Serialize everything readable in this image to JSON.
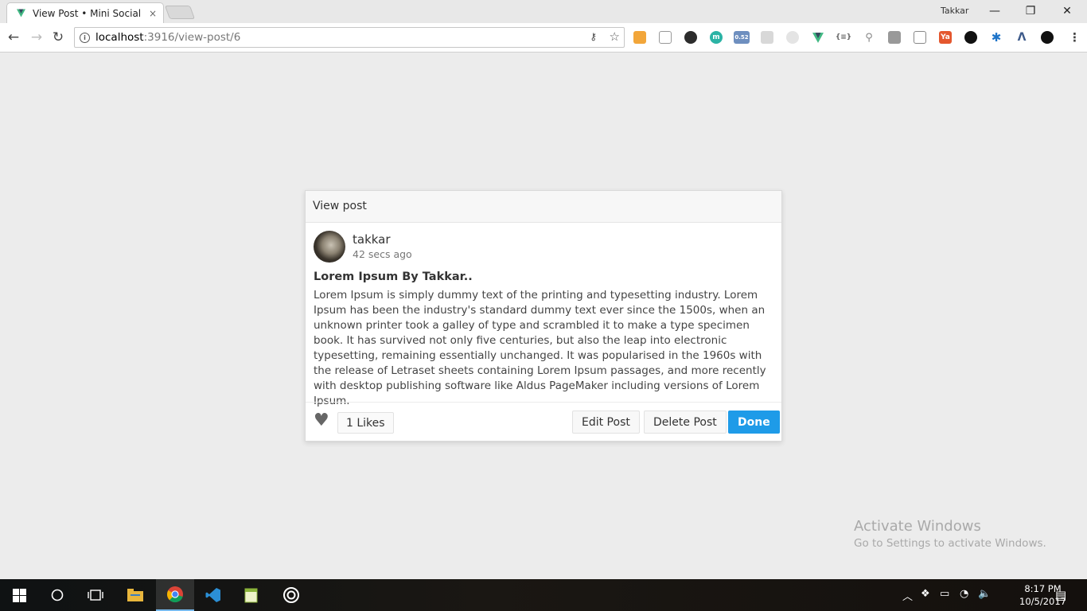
{
  "browser": {
    "tab_title": "View Post • Mini Social N",
    "tab_close": "×",
    "profile_name": "Takkar",
    "url_host": "localhost",
    "url_path": ":3916/view-post/6",
    "ext_badge": "0.52",
    "win_minimize": "—",
    "win_restore": "❐",
    "win_close": "✕"
  },
  "modal": {
    "header_title": "View post",
    "author_name": "takkar",
    "posted_time": "42 secs ago",
    "post_title": "Lorem Ipsum By Takkar..",
    "post_body": "Lorem Ipsum is simply dummy text of the printing and typesetting industry. Lorem Ipsum has been the industry's standard dummy text ever since the 1500s, when an unknown printer took a galley of type and scrambled it to make a type specimen book. It has survived not only five centuries, but also the leap into electronic typesetting, remaining essentially unchanged. It was popularised in the 1960s with the release of Letraset sheets containing Lorem Ipsum passages, and more recently with desktop publishing software like Aldus PageMaker including versions of Lorem Ipsum.",
    "likes_label": "1 Likes",
    "edit_label": "Edit Post",
    "delete_label": "Delete Post",
    "done_label": "Done"
  },
  "watermark": {
    "line1": "Activate Windows",
    "line2": "Go to Settings to activate Windows."
  },
  "taskbar": {
    "time": "8:17 PM",
    "date": "10/5/2017"
  },
  "colors": {
    "accent": "#1e9be8",
    "page_background": "#ececec"
  }
}
